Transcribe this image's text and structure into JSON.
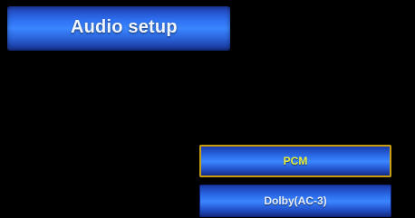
{
  "header": {
    "title": "Audio setup"
  },
  "options": [
    {
      "label": "PCM",
      "selected": true
    },
    {
      "label": "Dolby(AC-3)",
      "selected": false
    }
  ],
  "colors": {
    "background": "#000000",
    "bar_blue": "#2d6ff0",
    "highlight_border": "#c99d10",
    "selected_text": "#e6ef3c",
    "normal_text": "#e8eefc"
  }
}
